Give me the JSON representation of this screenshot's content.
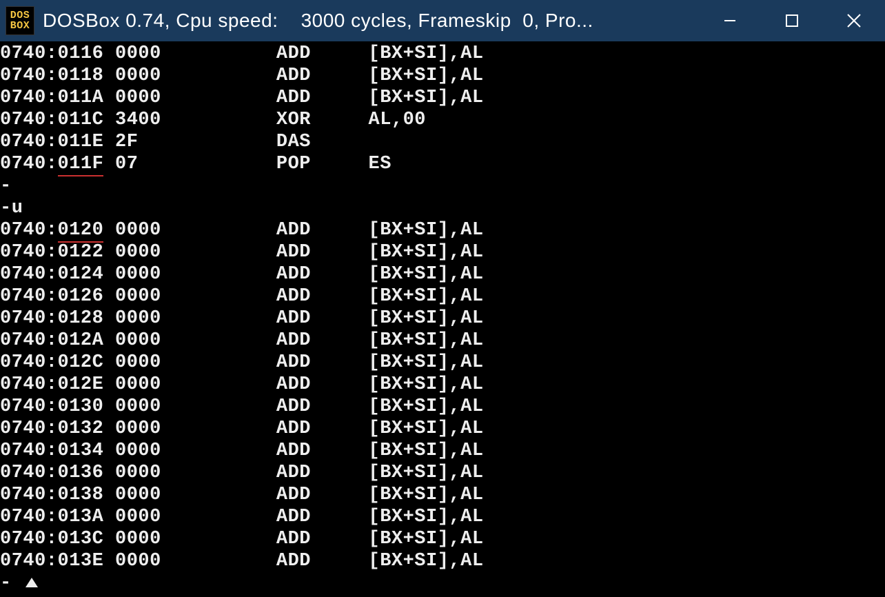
{
  "window": {
    "icon_top": "DOS",
    "icon_bottom": "BOX",
    "title": "DOSBox 0.74, Cpu speed:    3000 cycles, Frameskip  0, Pro..."
  },
  "colors": {
    "titlebar_bg": "#1a3a5c",
    "terminal_bg": "#000000",
    "terminal_fg": "#eeeeee",
    "underline": "#cc3030",
    "icon_fg": "#f4c542"
  },
  "cols": {
    "addr": 0,
    "bytes": 10,
    "mnemonic": 24,
    "operands": 32
  },
  "disasm_top": [
    {
      "addr": "0740:0116",
      "bytes": "0000",
      "mn": "ADD",
      "op": "[BX+SI],AL",
      "ul": false
    },
    {
      "addr": "0740:0118",
      "bytes": "0000",
      "mn": "ADD",
      "op": "[BX+SI],AL",
      "ul": false
    },
    {
      "addr": "0740:011A",
      "bytes": "0000",
      "mn": "ADD",
      "op": "[BX+SI],AL",
      "ul": false
    },
    {
      "addr": "0740:011C",
      "bytes": "3400",
      "mn": "XOR",
      "op": "AL,00",
      "ul": false
    },
    {
      "addr": "0740:011E",
      "bytes": "2F",
      "mn": "DAS",
      "op": "",
      "ul": false
    },
    {
      "addr": "0740:011F",
      "bytes": "07",
      "mn": "POP",
      "op": "ES",
      "ul": true
    }
  ],
  "prompt1": "-",
  "cmd": "-u",
  "disasm_bottom": [
    {
      "addr": "0740:0120",
      "bytes": "0000",
      "mn": "ADD",
      "op": "[BX+SI],AL",
      "ul": true
    },
    {
      "addr": "0740:0122",
      "bytes": "0000",
      "mn": "ADD",
      "op": "[BX+SI],AL",
      "ul": false
    },
    {
      "addr": "0740:0124",
      "bytes": "0000",
      "mn": "ADD",
      "op": "[BX+SI],AL",
      "ul": false
    },
    {
      "addr": "0740:0126",
      "bytes": "0000",
      "mn": "ADD",
      "op": "[BX+SI],AL",
      "ul": false
    },
    {
      "addr": "0740:0128",
      "bytes": "0000",
      "mn": "ADD",
      "op": "[BX+SI],AL",
      "ul": false
    },
    {
      "addr": "0740:012A",
      "bytes": "0000",
      "mn": "ADD",
      "op": "[BX+SI],AL",
      "ul": false
    },
    {
      "addr": "0740:012C",
      "bytes": "0000",
      "mn": "ADD",
      "op": "[BX+SI],AL",
      "ul": false
    },
    {
      "addr": "0740:012E",
      "bytes": "0000",
      "mn": "ADD",
      "op": "[BX+SI],AL",
      "ul": false
    },
    {
      "addr": "0740:0130",
      "bytes": "0000",
      "mn": "ADD",
      "op": "[BX+SI],AL",
      "ul": false
    },
    {
      "addr": "0740:0132",
      "bytes": "0000",
      "mn": "ADD",
      "op": "[BX+SI],AL",
      "ul": false
    },
    {
      "addr": "0740:0134",
      "bytes": "0000",
      "mn": "ADD",
      "op": "[BX+SI],AL",
      "ul": false
    },
    {
      "addr": "0740:0136",
      "bytes": "0000",
      "mn": "ADD",
      "op": "[BX+SI],AL",
      "ul": false
    },
    {
      "addr": "0740:0138",
      "bytes": "0000",
      "mn": "ADD",
      "op": "[BX+SI],AL",
      "ul": false
    },
    {
      "addr": "0740:013A",
      "bytes": "0000",
      "mn": "ADD",
      "op": "[BX+SI],AL",
      "ul": false
    },
    {
      "addr": "0740:013C",
      "bytes": "0000",
      "mn": "ADD",
      "op": "[BX+SI],AL",
      "ul": false
    },
    {
      "addr": "0740:013E",
      "bytes": "0000",
      "mn": "ADD",
      "op": "[BX+SI],AL",
      "ul": false
    }
  ],
  "prompt2": "- "
}
